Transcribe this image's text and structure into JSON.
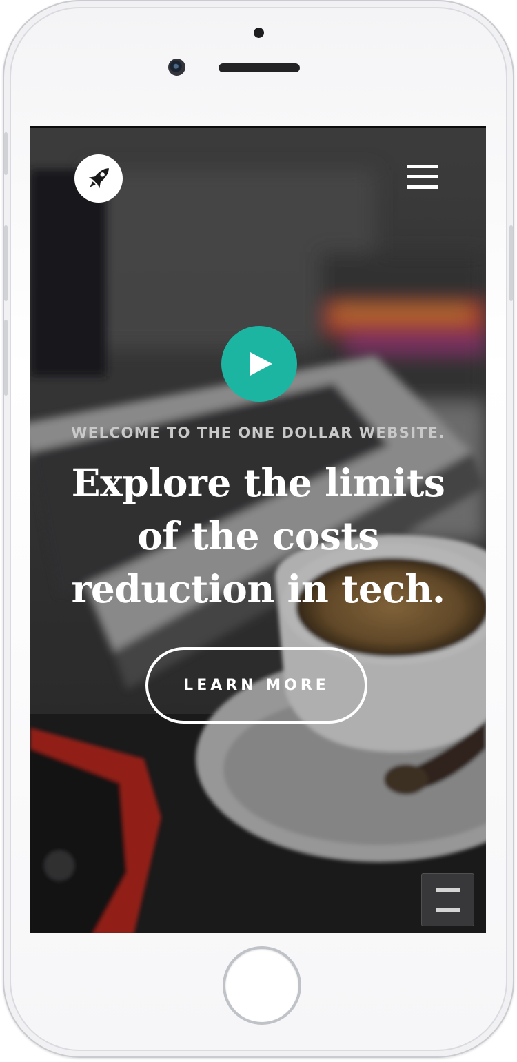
{
  "hero": {
    "tagline": "WELCOME TO THE ONE DOLLAR WEBSITE.",
    "headline_lines": [
      "Explore the limits",
      "of the costs",
      "reduction in tech."
    ],
    "cta_label": "LEARN MORE"
  },
  "icons": {
    "logo": "rocket-icon",
    "nav": "hamburger-menu-icon",
    "play": "play-icon",
    "floating": "menu-toggle-icon"
  },
  "colors": {
    "accent": "#1bb5a2",
    "text_primary": "#ffffff",
    "text_muted": "#c9c9c9"
  }
}
